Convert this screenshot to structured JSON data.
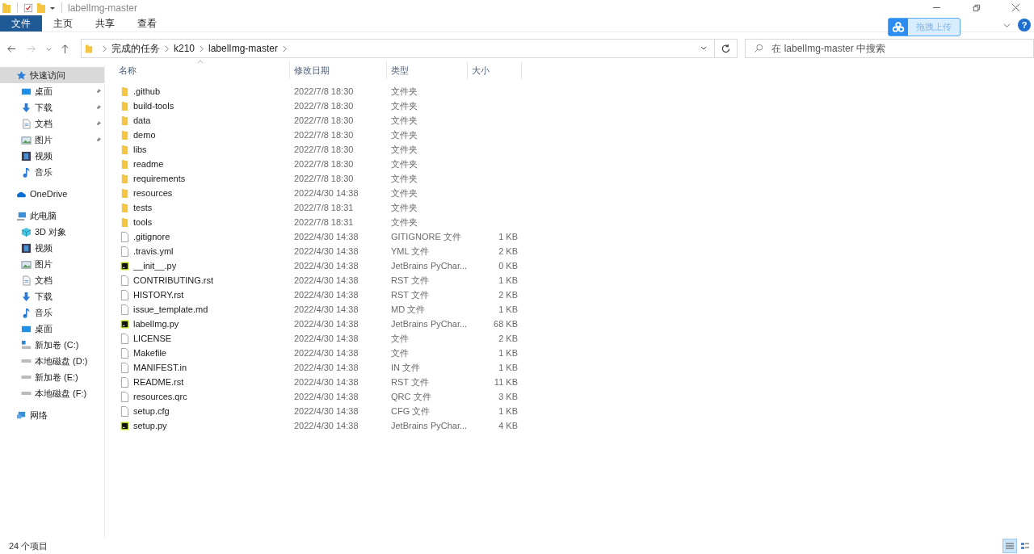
{
  "window": {
    "title": "labelImg-master"
  },
  "ribbon_tabs": [
    {
      "label": "文件",
      "selected": true
    },
    {
      "label": "主页",
      "selected": false
    },
    {
      "label": "共享",
      "selected": false
    },
    {
      "label": "查看",
      "selected": false
    }
  ],
  "upload_widget": {
    "label": "拖拽上传"
  },
  "help": "?",
  "breadcrumb": [
    "完成的任务",
    "k210",
    "labelImg-master"
  ],
  "search": {
    "placeholder": "在 labelImg-master 中搜索"
  },
  "sidebar": {
    "items": [
      {
        "label": "快速访问",
        "kind": "star",
        "selected": true,
        "children": [
          {
            "label": "桌面",
            "kind": "desktop",
            "pinned": true,
            "selected": false
          },
          {
            "label": "下载",
            "kind": "download",
            "pinned": true,
            "selected": false
          },
          {
            "label": "文档",
            "kind": "document",
            "pinned": true,
            "selected": false
          },
          {
            "label": "图片",
            "kind": "pictures",
            "pinned": true,
            "selected": false
          },
          {
            "label": "视频",
            "kind": "video",
            "pinned": false,
            "selected": false
          },
          {
            "label": "音乐",
            "kind": "music",
            "pinned": false,
            "selected": false
          }
        ]
      },
      {
        "label": "OneDrive",
        "kind": "cloud",
        "selected": false
      },
      {
        "label": "此电脑",
        "kind": "computer",
        "selected": false,
        "children": [
          {
            "label": "3D 对象",
            "kind": "cube",
            "selected": false
          },
          {
            "label": "视频",
            "kind": "video",
            "selected": false
          },
          {
            "label": "图片",
            "kind": "pictures",
            "selected": false
          },
          {
            "label": "文档",
            "kind": "document",
            "selected": false
          },
          {
            "label": "下载",
            "kind": "download",
            "selected": false
          },
          {
            "label": "音乐",
            "kind": "music",
            "selected": false
          },
          {
            "label": "桌面",
            "kind": "desktop",
            "selected": false
          },
          {
            "label": "新加卷 (C:)",
            "kind": "system-drive",
            "selected": false
          },
          {
            "label": "本地磁盘 (D:)",
            "kind": "drive",
            "selected": false
          },
          {
            "label": "新加卷 (E:)",
            "kind": "drive",
            "selected": false
          },
          {
            "label": "本地磁盘 (F:)",
            "kind": "drive",
            "selected": false
          }
        ]
      },
      {
        "label": "网络",
        "kind": "network",
        "selected": false
      }
    ]
  },
  "table": {
    "columns": [
      "名称",
      "修改日期",
      "类型",
      "大小"
    ],
    "rows": [
      {
        "name": ".github",
        "modified": "2022/7/8 18:30",
        "type": "文件夹",
        "kind": "folder"
      },
      {
        "name": "build-tools",
        "modified": "2022/7/8 18:30",
        "type": "文件夹",
        "kind": "folder"
      },
      {
        "name": "data",
        "modified": "2022/7/8 18:30",
        "type": "文件夹",
        "kind": "folder"
      },
      {
        "name": "demo",
        "modified": "2022/7/8 18:30",
        "type": "文件夹",
        "kind": "folder"
      },
      {
        "name": "libs",
        "modified": "2022/7/8 18:30",
        "type": "文件夹",
        "kind": "folder"
      },
      {
        "name": "readme",
        "modified": "2022/7/8 18:30",
        "type": "文件夹",
        "kind": "folder"
      },
      {
        "name": "requirements",
        "modified": "2022/7/8 18:30",
        "type": "文件夹",
        "kind": "folder"
      },
      {
        "name": "resources",
        "modified": "2022/4/30 14:38",
        "type": "文件夹",
        "kind": "folder"
      },
      {
        "name": "tests",
        "modified": "2022/7/8 18:31",
        "type": "文件夹",
        "kind": "folder"
      },
      {
        "name": "tools",
        "modified": "2022/7/8 18:31",
        "type": "文件夹",
        "kind": "folder"
      },
      {
        "name": ".gitignore",
        "modified": "2022/4/30 14:38",
        "type": "GITIGNORE 文件",
        "size": "1 KB",
        "kind": "file"
      },
      {
        "name": ".travis.yml",
        "modified": "2022/4/30 14:38",
        "type": "YML 文件",
        "size": "2 KB",
        "kind": "file"
      },
      {
        "name": "__init__.py",
        "modified": "2022/4/30 14:38",
        "type": "JetBrains PyChar...",
        "size": "0 KB",
        "kind": "python"
      },
      {
        "name": "CONTRIBUTING.rst",
        "modified": "2022/4/30 14:38",
        "type": "RST 文件",
        "size": "1 KB",
        "kind": "file"
      },
      {
        "name": "HISTORY.rst",
        "modified": "2022/4/30 14:38",
        "type": "RST 文件",
        "size": "2 KB",
        "kind": "file"
      },
      {
        "name": "issue_template.md",
        "modified": "2022/4/30 14:38",
        "type": "MD 文件",
        "size": "1 KB",
        "kind": "file"
      },
      {
        "name": "labelImg.py",
        "modified": "2022/4/30 14:38",
        "type": "JetBrains PyChar...",
        "size": "68 KB",
        "kind": "python"
      },
      {
        "name": "LICENSE",
        "modified": "2022/4/30 14:38",
        "type": "文件",
        "size": "2 KB",
        "kind": "file"
      },
      {
        "name": "Makefile",
        "modified": "2022/4/30 14:38",
        "type": "文件",
        "size": "1 KB",
        "kind": "file"
      },
      {
        "name": "MANIFEST.in",
        "modified": "2022/4/30 14:38",
        "type": "IN 文件",
        "size": "1 KB",
        "kind": "file"
      },
      {
        "name": "README.rst",
        "modified": "2022/4/30 14:38",
        "type": "RST 文件",
        "size": "11 KB",
        "kind": "file"
      },
      {
        "name": "resources.qrc",
        "modified": "2022/4/30 14:38",
        "type": "QRC 文件",
        "size": "3 KB",
        "kind": "file"
      },
      {
        "name": "setup.cfg",
        "modified": "2022/4/30 14:38",
        "type": "CFG 文件",
        "size": "1 KB",
        "kind": "file"
      },
      {
        "name": "setup.py",
        "modified": "2022/4/30 14:38",
        "type": "JetBrains PyChar...",
        "size": "4 KB",
        "kind": "python"
      }
    ]
  },
  "status_bar": {
    "item_count": "24 个项目",
    "view_modes": [
      {
        "kind": "details",
        "selected": true
      },
      {
        "kind": "tiles",
        "selected": false
      }
    ]
  }
}
